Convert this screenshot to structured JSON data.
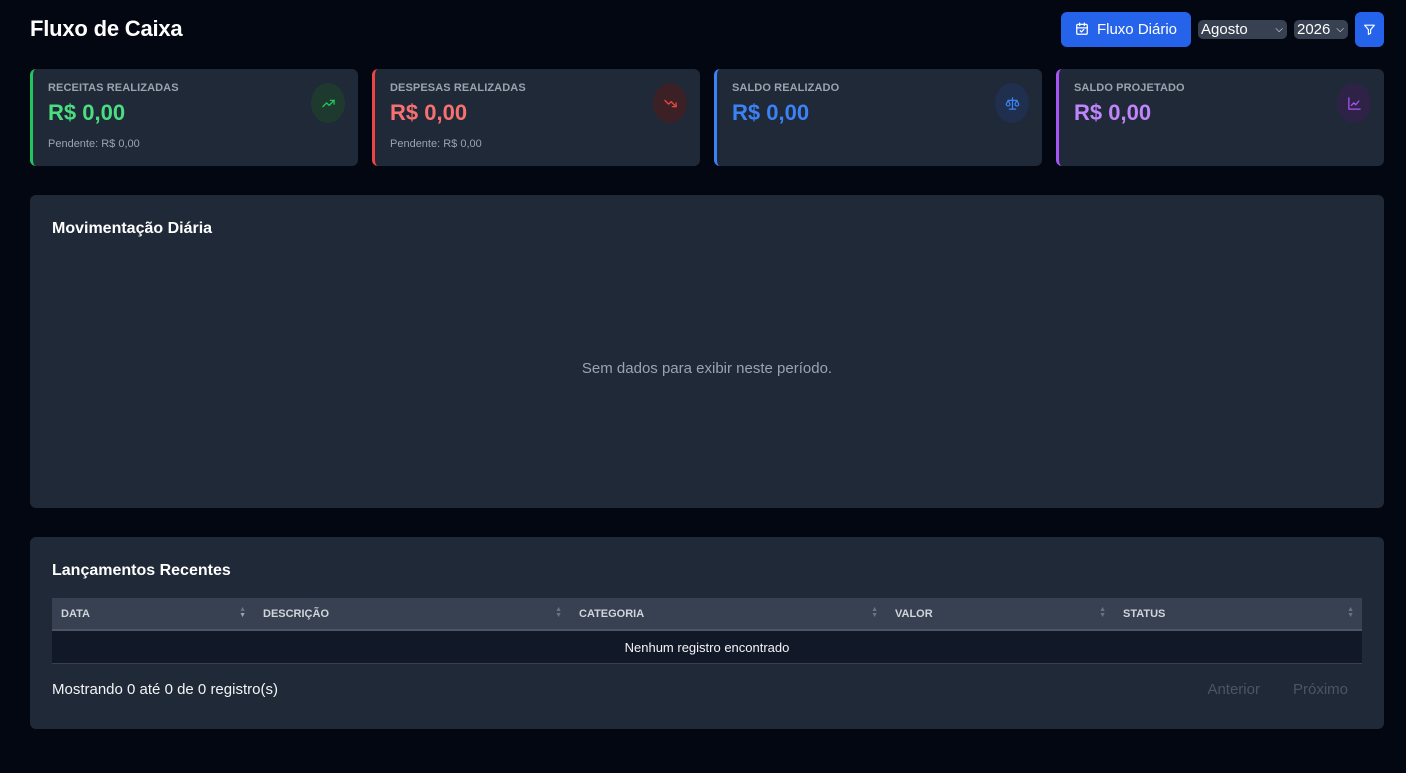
{
  "header": {
    "title": "Fluxo de Caixa",
    "daily_button": "Fluxo Diário",
    "month": "Agosto",
    "year": "2026"
  },
  "cards": [
    {
      "label": "RECEITAS REALIZADAS",
      "value": "R$ 0,00",
      "sub": "Pendente: R$ 0,00",
      "color": "#22c55e",
      "icon": "trending-up-icon"
    },
    {
      "label": "DESPESAS REALIZADAS",
      "value": "R$ 0,00",
      "sub": "Pendente: R$ 0,00",
      "color": "#ef4444",
      "icon": "trending-down-icon"
    },
    {
      "label": "SALDO REALIZADO",
      "value": "R$ 0,00",
      "sub": "",
      "color": "#3b82f6",
      "icon": "scale-icon"
    },
    {
      "label": "SALDO PROJETADO",
      "value": "R$ 0,00",
      "sub": "",
      "color": "#a855f7",
      "icon": "chart-line-icon"
    }
  ],
  "chart_panel": {
    "title": "Movimentação Diária",
    "empty_message": "Sem dados para exibir neste período."
  },
  "table_panel": {
    "title": "Lançamentos Recentes",
    "columns": [
      "DATA",
      "DESCRIÇÃO",
      "CATEGORIA",
      "VALOR",
      "STATUS"
    ],
    "empty_row": "Nenhum registro encontrado",
    "info": "Mostrando 0 até 0 de 0 registro(s)",
    "prev": "Anterior",
    "next": "Próximo"
  }
}
